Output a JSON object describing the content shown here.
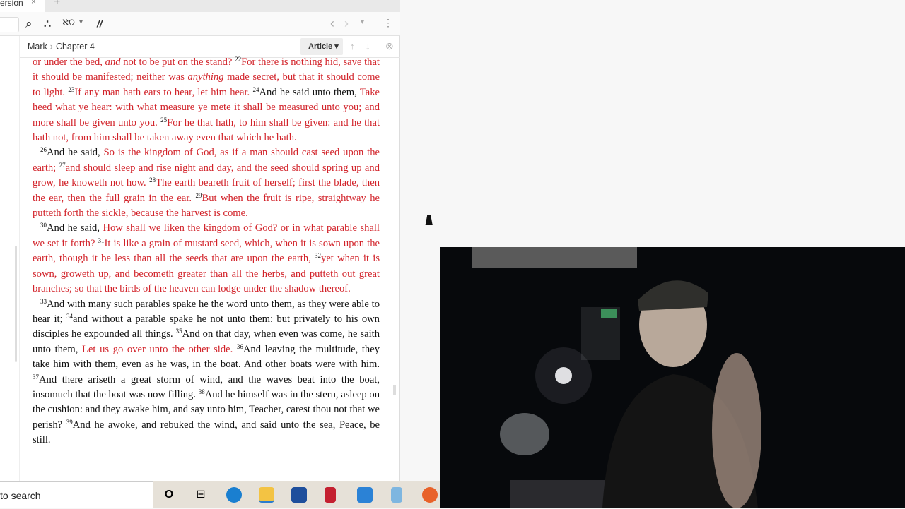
{
  "tab": {
    "label": "ersion",
    "close": "×",
    "new": "+"
  },
  "toolbar": {
    "search": "⌕",
    "visual_filters": "∴",
    "interlinear": "ℵΩ",
    "dropdown": "▾",
    "parallel": "//",
    "back": "‹",
    "forward": "›",
    "history": "▾",
    "more": "⋮"
  },
  "breadcrumb": {
    "book": "Mark",
    "sep": "›",
    "chapter": "Chapter 4"
  },
  "article": {
    "label": "Article ▾",
    "up": "↑",
    "down": "↓",
    "close": "⊗"
  },
  "paragraphs": [
    [
      {
        "t": "or under the bed, ",
        "r": 1
      },
      {
        "t": "and",
        "r": 1,
        "i": 1
      },
      {
        "t": " not to be put on the stand? ",
        "r": 1
      },
      {
        "v": "22"
      },
      {
        "t": "For there is nothing hid, save that it should be manifested; neither was ",
        "r": 1
      },
      {
        "t": "anything",
        "r": 1,
        "i": 1
      },
      {
        "t": " made secret, but that it should come to light. ",
        "r": 1
      },
      {
        "v": "23"
      },
      {
        "t": "If any man hath ears to hear, let him hear. ",
        "r": 1
      },
      {
        "v": "24"
      },
      {
        "t": "And he said unto them, "
      },
      {
        "t": "Take heed what ye hear: with what measure ye mete it shall be measured unto you; and more shall be given unto you. ",
        "r": 1
      },
      {
        "v": "25"
      },
      {
        "t": "For he that hath, to him shall be given: and he that hath not, from him shall be taken away even that which he hath.",
        "r": 1
      }
    ],
    [
      {
        "v": "26"
      },
      {
        "t": "And he said, "
      },
      {
        "t": "So is the kingdom of God, as if a man should cast seed upon the earth; ",
        "r": 1
      },
      {
        "v": "27"
      },
      {
        "t": "and should sleep and rise night and day, and the seed should spring up and grow, he knoweth not how. ",
        "r": 1
      },
      {
        "v": "28"
      },
      {
        "t": "The earth beareth fruit of herself; first the blade, then the ear, then the full grain in the ear. ",
        "r": 1
      },
      {
        "v": "29"
      },
      {
        "t": "But when the fruit is ripe, straightway he putteth forth the sickle, because the harvest is come.",
        "r": 1
      }
    ],
    [
      {
        "v": "30"
      },
      {
        "t": "And he said, "
      },
      {
        "t": "How shall we liken the kingdom of God? or in what parable shall we set it forth? ",
        "r": 1
      },
      {
        "v": "31"
      },
      {
        "t": "It is like a grain of mustard seed, which, when it is sown upon the earth, though it be less than all the seeds that are upon the earth, ",
        "r": 1
      },
      {
        "v": "32"
      },
      {
        "t": "yet when it is sown, groweth up, and becometh greater than all the herbs, and putteth out great branches; so that the birds of the heaven can lodge under the shadow thereof.",
        "r": 1
      }
    ],
    [
      {
        "v": "33"
      },
      {
        "t": "And with many such parables spake he the word unto them, as they were able to hear it; "
      },
      {
        "v": "34"
      },
      {
        "t": "and without a parable spake he not unto them: but privately to his own disciples he expounded all things. "
      },
      {
        "v": "35"
      },
      {
        "t": "And on that day, when even was come, he saith unto them, "
      },
      {
        "t": "Let us go over unto the other side. ",
        "r": 1
      },
      {
        "v": "36"
      },
      {
        "t": "And leaving the multitude, they take him with them, even as he was, in the boat. And other boats were with him. "
      },
      {
        "v": "37"
      },
      {
        "t": "And there ariseth a great storm of wind, and the waves beat into the boat, insomuch that the boat was now filling. "
      },
      {
        "v": "38"
      },
      {
        "t": "And he himself was in the stern, asleep on the cushion: and they awake him, and say unto him, Teacher, carest thou not that we perish? "
      },
      {
        "v": "39"
      },
      {
        "t": "And he awoke, and rebuked the wind, and said unto the sea, Peace, be still."
      }
    ]
  ],
  "taskbar": {
    "search": "to search",
    "cortana": "O",
    "taskview": "⊟"
  },
  "colors": {
    "red_letter": "#d2232a"
  }
}
